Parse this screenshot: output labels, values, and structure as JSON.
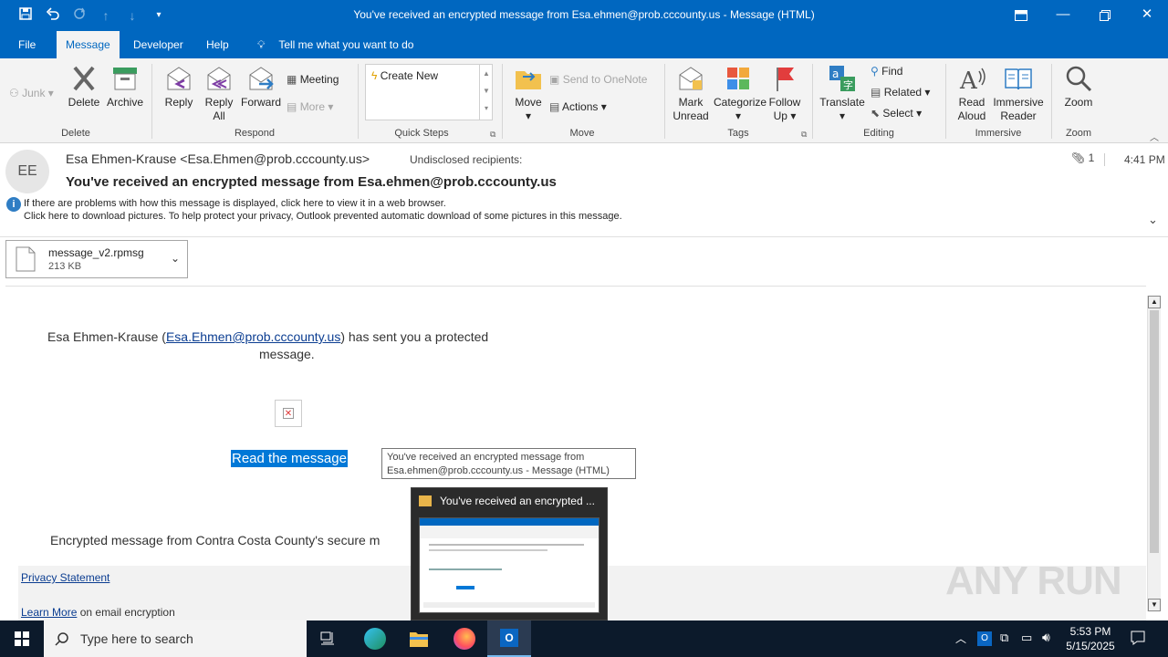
{
  "window": {
    "title": "You've received an encrypted message from Esa.ehmen@prob.cccounty.us  -  Message (HTML)"
  },
  "tabs": [
    "File",
    "Message",
    "Developer",
    "Help"
  ],
  "tell_me": "Tell me what you want to do",
  "ribbon": {
    "junk": "Junk",
    "delete": "Delete",
    "archive": "Archive",
    "reply": "Reply",
    "reply_all_1": "Reply",
    "reply_all_2": "All",
    "forward": "Forward",
    "meeting": "Meeting",
    "more": "More",
    "create_new": "Create New",
    "move": "Move",
    "send_to_onenote": "Send to OneNote",
    "actions": "Actions",
    "mark_unread_1": "Mark",
    "mark_unread_2": "Unread",
    "categorize": "Categorize",
    "follow_up_1": "Follow",
    "follow_up_2": "Up",
    "translate": "Translate",
    "find": "Find",
    "related": "Related",
    "select": "Select",
    "read_aloud_1": "Read",
    "read_aloud_2": "Aloud",
    "immersive_reader_1": "Immersive",
    "immersive_reader_2": "Reader",
    "zoom": "Zoom",
    "groups": {
      "delete": "Delete",
      "respond": "Respond",
      "quick_steps": "Quick Steps",
      "move": "Move",
      "tags": "Tags",
      "editing": "Editing",
      "immersive": "Immersive",
      "zoom": "Zoom"
    }
  },
  "message": {
    "avatar_initials": "EE",
    "from": "Esa Ehmen-Krause <Esa.Ehmen@prob.cccounty.us>",
    "to": "Undisclosed recipients:",
    "attachment_count": "1",
    "time": "4:41 PM",
    "subject": "You've received an encrypted message from Esa.ehmen@prob.cccounty.us",
    "info_line_1": "If there are problems with how this message is displayed, click here to view it in a web browser.",
    "info_line_2": "Click here to download pictures. To help protect your privacy, Outlook prevented automatic download of some pictures in this message."
  },
  "attachment": {
    "name": "message_v2.rpmsg",
    "size": "213 KB"
  },
  "body": {
    "sender_name": "Esa Ehmen-Krause (",
    "sender_link": "Esa.Ehmen@prob.cccounty.us",
    "sent_text": ") has sent you a protected",
    "sent_text_2": "message.",
    "read_button": "Read the message",
    "footer_text": "Encrypted message from Contra Costa County's secure m",
    "privacy": "Privacy Statement",
    "learn_more": "Learn More",
    "learn_more_suffix": " on email encryption"
  },
  "tooltip": {
    "line1": "You've received an encrypted message from",
    "line2": "Esa.ehmen@prob.cccounty.us  - Message (HTML)"
  },
  "popup": {
    "title": "You've received an encrypted ..."
  },
  "taskbar": {
    "search_placeholder": "Type here to search",
    "time": "5:53 PM",
    "date": "5/15/2025"
  },
  "watermark": "ANY RUN"
}
